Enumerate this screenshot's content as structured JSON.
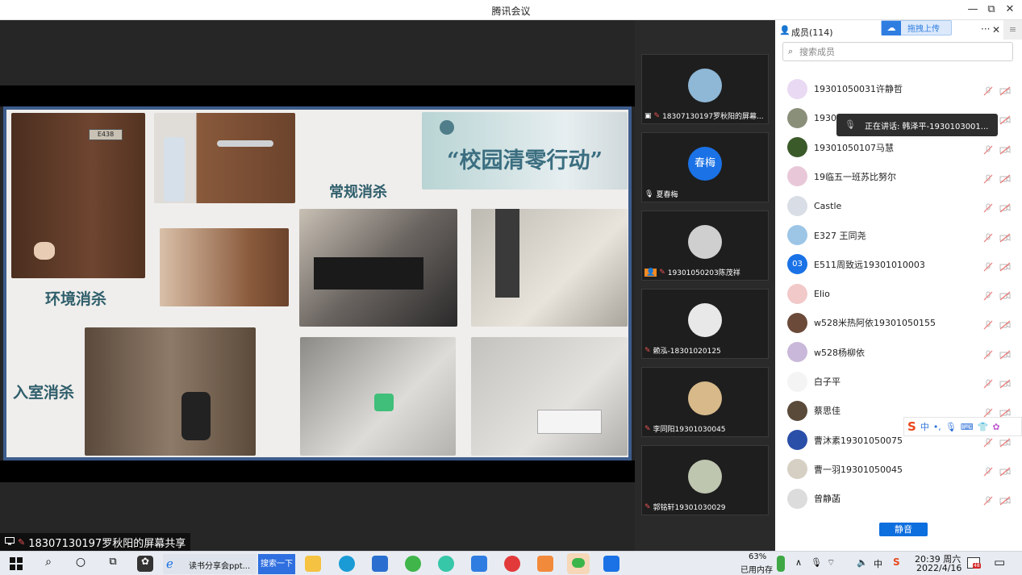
{
  "window": {
    "title": "腾讯会议",
    "min": "—",
    "max": "⧉",
    "close": "✕"
  },
  "slide": {
    "title": "“校园清零行动”",
    "label_routine": "常规消杀",
    "label_env": "环境消杀",
    "label_entry": "入室消杀",
    "door_number": "E438"
  },
  "share": {
    "label": "18307130197罗秋阳的屏幕共享"
  },
  "video_tiles": [
    {
      "name": "18307130197罗秋阳的屏幕...",
      "avatar_color": "#8fb7d6"
    },
    {
      "name": "夏春梅",
      "avatar_text": "春梅",
      "avatar_color": "#1a72e6"
    },
    {
      "name": "19301050203陈茂祥",
      "avatar_color": "#cfcfcf"
    },
    {
      "name": "赖泓-18301020125",
      "avatar_color": "#e8e8e8"
    },
    {
      "name": "李同阳19301030045",
      "avatar_color": "#d7b98a"
    },
    {
      "name": "郭铭轩19301030029",
      "avatar_color": "#bfc6b0"
    }
  ],
  "panel": {
    "members_label": "成员(114)",
    "upload_label": "拖拽上传",
    "more": "···",
    "close": "✕",
    "search_placeholder": "搜索成员",
    "speaking": "正在讲话: 韩泽平-1930103001...",
    "mute_all": "静音"
  },
  "members": [
    {
      "name": "19301050031许静哲",
      "avatar_color": "#e9d9f2"
    },
    {
      "name": "1930",
      "avatar_color": "#8a8f7a"
    },
    {
      "name": "19301050107马慧",
      "avatar_color": "#3a5a2a"
    },
    {
      "name": "19临五一班苏比努尔",
      "avatar_color": "#e8c8d8"
    },
    {
      "name": "Castle",
      "avatar_color": "#d9dde6"
    },
    {
      "name": "E327 王同尧",
      "avatar_color": "#9cc5e6"
    },
    {
      "name": "E511周致远19301010003",
      "avatar_text": "03",
      "avatar_color": "#1a72e6"
    },
    {
      "name": "Elio",
      "avatar_color": "#f2c9c9"
    },
    {
      "name": "w528米热阿依19301050155",
      "avatar_color": "#6b4a3a"
    },
    {
      "name": "w528杨柳依",
      "avatar_color": "#c9b8d9"
    },
    {
      "name": "白子平",
      "avatar_color": "#f4f4f4"
    },
    {
      "name": "蔡思佳",
      "avatar_color": "#5a4a3a"
    },
    {
      "name": "曹沐素19301050075",
      "avatar_color": "#2a4fa8"
    },
    {
      "name": "曹一羽19301050045",
      "avatar_color": "#d6d0c4"
    },
    {
      "name": "曾静菡",
      "avatar_color": "#dcdcdc"
    }
  ],
  "ime": {
    "lang": "中",
    "punct": "•,",
    "brand": "S"
  },
  "taskbar": {
    "ie_label": "读书分享会ppt...",
    "search_btn": "搜索一下",
    "mem_pct": "63%",
    "mem_label": "已用内存",
    "time": "20:39 周六",
    "date": "2022/4/16",
    "ime_lang": "中",
    "notify_count": "48"
  }
}
